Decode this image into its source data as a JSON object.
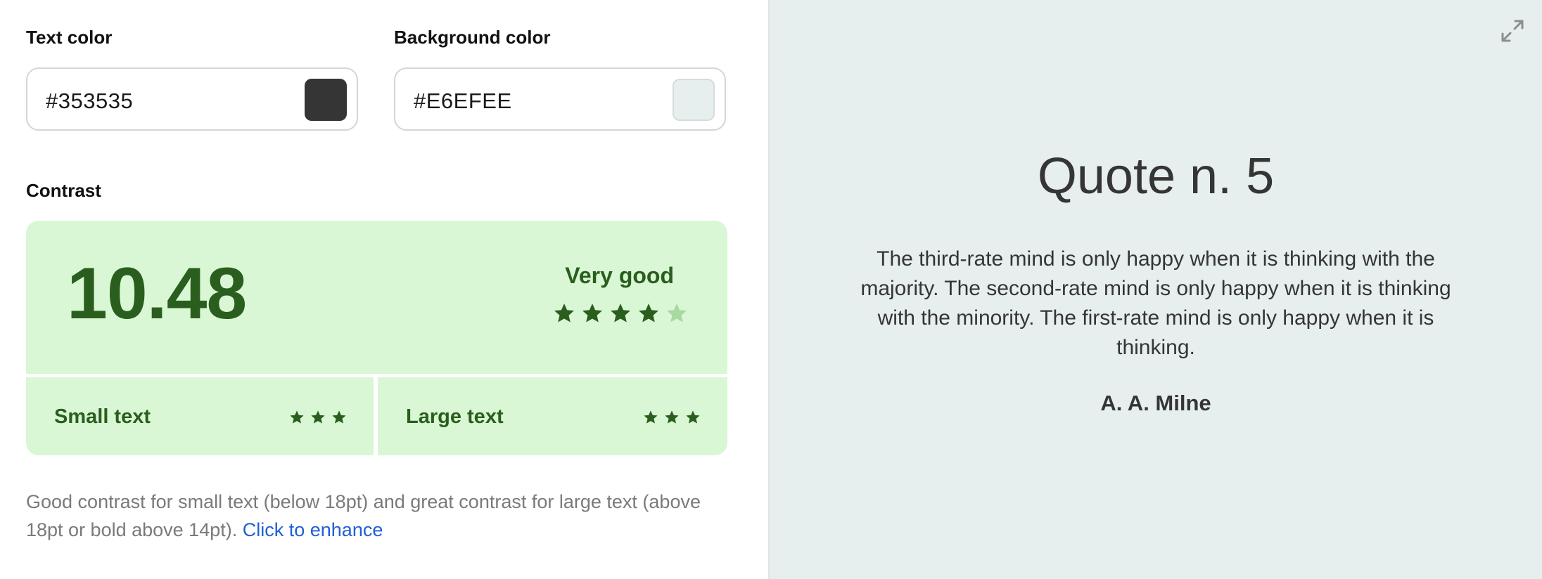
{
  "text_color": {
    "label": "Text color",
    "value": "#353535",
    "swatch": "#353535"
  },
  "background_color": {
    "label": "Background color",
    "value": "#E6EFEE",
    "swatch": "#E6EEEE"
  },
  "contrast": {
    "label": "Contrast",
    "ratio": "10.48",
    "rating": "Very good",
    "stars_filled": 4,
    "stars_total": 5,
    "small_text": {
      "label": "Small text",
      "stars": 3
    },
    "large_text": {
      "label": "Large text",
      "stars": 3
    },
    "colors": {
      "card_bg": "#D9F7D5",
      "accent": "#2A5E1E",
      "star_empty": "#A9D8A0"
    }
  },
  "description": {
    "text": "Good contrast for small text (below 18pt) and great contrast for large text (above 18pt or bold above 14pt).",
    "link": "Click to enhance"
  },
  "preview": {
    "title": "Quote n. 5",
    "body": "The third-rate mind is only happy when it is thinking with the majority. The second-rate mind is only happy when it is thinking with the minority. The first-rate mind is only happy when it is thinking.",
    "author": "A. A. Milne",
    "expand_icon": "expand-icon"
  }
}
